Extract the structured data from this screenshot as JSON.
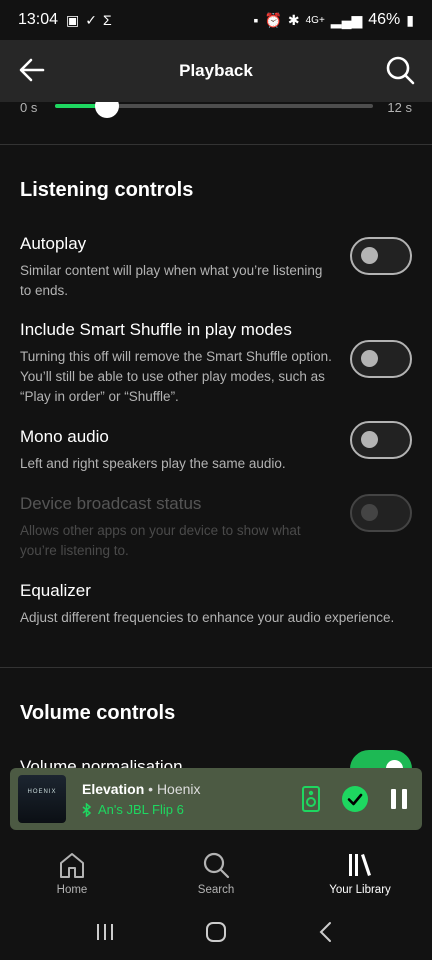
{
  "status_bar": {
    "time": "13:04",
    "network": "4G+",
    "battery": "46%"
  },
  "header": {
    "title": "Playback"
  },
  "crossfade": {
    "min_label": "0 s",
    "max_label": "12 s",
    "value_fraction": 0.165
  },
  "sections": {
    "listening_title": "Listening controls",
    "volume_title": "Volume controls"
  },
  "settings": {
    "autoplay": {
      "label": "Autoplay",
      "desc": "Similar content will play when what you’re listening to ends.",
      "enabled": false
    },
    "smart_shuffle": {
      "label": "Include Smart Shuffle in play modes",
      "desc": "Turning this off will remove the Smart Shuffle option. You’ll still be able to use other play modes, such as “Play in order” or “Shuffle”.",
      "enabled": false
    },
    "mono": {
      "label": "Mono audio",
      "desc": "Left and right speakers play the same audio.",
      "enabled": false
    },
    "broadcast": {
      "label": "Device broadcast status",
      "desc": "Allows other apps on your device to show what you’re listening to.",
      "enabled": false,
      "disabled": true
    },
    "equalizer": {
      "label": "Equalizer",
      "desc": "Adjust different frequencies to enhance your audio experience."
    },
    "normalisation": {
      "label": "Volume normalisation",
      "enabled": true
    }
  },
  "mini_player": {
    "song": "Elevation",
    "separator": " • ",
    "artist": "Hoenix",
    "device": "An's JBL Flip 6",
    "art_text": "HOENIX"
  },
  "bottom_nav": {
    "items": [
      {
        "label": "Home"
      },
      {
        "label": "Search"
      },
      {
        "label": "Your Library"
      }
    ]
  },
  "colors": {
    "accent": "#1ed760",
    "background": "#121212",
    "app_bar": "#272727",
    "mini_player": "#4c5a43"
  }
}
